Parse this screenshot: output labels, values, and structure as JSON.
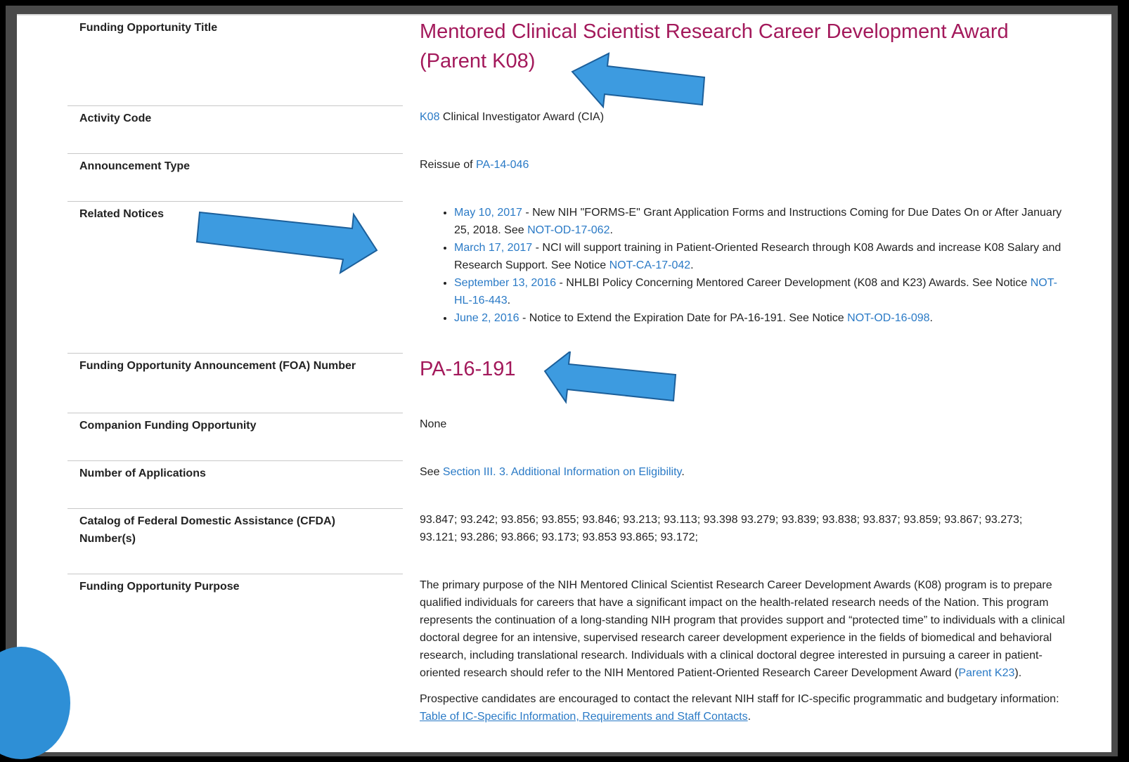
{
  "rows": {
    "title": {
      "label": "Funding Opportunity Title",
      "value_line1": "Mentored Clinical Scientist Research Career Development Award",
      "value_line2": "(Parent K08)"
    },
    "activity": {
      "label": "Activity Code",
      "code_link": "K08",
      "text": " Clinical Investigator Award (CIA)"
    },
    "announcement": {
      "label": "Announcement Type",
      "prefix": "Reissue of ",
      "link": "PA-14-046"
    },
    "notices": {
      "label": "Related Notices",
      "items": [
        {
          "date": "May 10, 2017",
          "text": " - New NIH \"FORMS-E\" Grant Application Forms and Instructions Coming for Due Dates On or After January 25, 2018. See ",
          "link": "NOT-OD-17-062",
          "end": "."
        },
        {
          "date": "March 17, 2017",
          "text": " - NCI will support training in Patient-Oriented Research through K08 Awards and increase K08 Salary and Research Support. See Notice ",
          "link": "NOT-CA-17-042",
          "end": "."
        },
        {
          "date": "September 13, 2016",
          "text": " - NHLBI Policy Concerning Mentored Career Development (K08 and K23) Awards. See Notice ",
          "link": "NOT-HL-16-443",
          "end": "."
        },
        {
          "date": "June 2, 2016",
          "text": " - Notice to Extend the Expiration Date for PA-16-191. See Notice ",
          "link": "NOT-OD-16-098",
          "end": "."
        }
      ]
    },
    "foa": {
      "label": "Funding Opportunity Announcement (FOA) Number",
      "value": "PA-16-191"
    },
    "companion": {
      "label": "Companion Funding Opportunity",
      "value": "None"
    },
    "applications": {
      "label": "Number of Applications",
      "prefix": "See ",
      "link": "Section III. 3. Additional Information on Eligibility",
      "end": "."
    },
    "cfda": {
      "label": "Catalog of Federal Domestic Assistance (CFDA) Number(s)",
      "value": "93.847; 93.242; 93.856; 93.855; 93.846; 93.213; 93.113; 93.398 93.279; 93.839; 93.838; 93.837; 93.859; 93.867; 93.273; 93.121; 93.286; 93.866; 93.173; 93.853 93.865; 93.172;"
    },
    "purpose": {
      "label": "Funding Opportunity Purpose",
      "p1_text": "The primary purpose of the NIH Mentored Clinical Scientist Research Career Development Awards (K08) program is to prepare qualified individuals for careers that have a significant impact on the health-related research needs of the Nation. This program represents the continuation of a long-standing NIH program that provides support and “protected time” to individuals with a clinical doctoral degree for an intensive, supervised research career development experience in the fields of biomedical and behavioral research, including translational research. Individuals with a clinical doctoral degree interested in pursuing a career in patient-oriented research should refer to the NIH Mentored Patient-Oriented Research Career Development Award (",
      "p1_link": "Parent K23",
      "p1_end": ").",
      "p2_text": "Prospective candidates are encouraged to contact the relevant NIH staff for IC-specific programmatic and budgetary information: ",
      "p2_link": "Table of IC-Specific Information, Requirements and Staff Contacts",
      "p2_end": "."
    }
  },
  "colors": {
    "title": "#a3195b",
    "link": "#2a7ac6",
    "arrow": "#2e8fd6"
  }
}
